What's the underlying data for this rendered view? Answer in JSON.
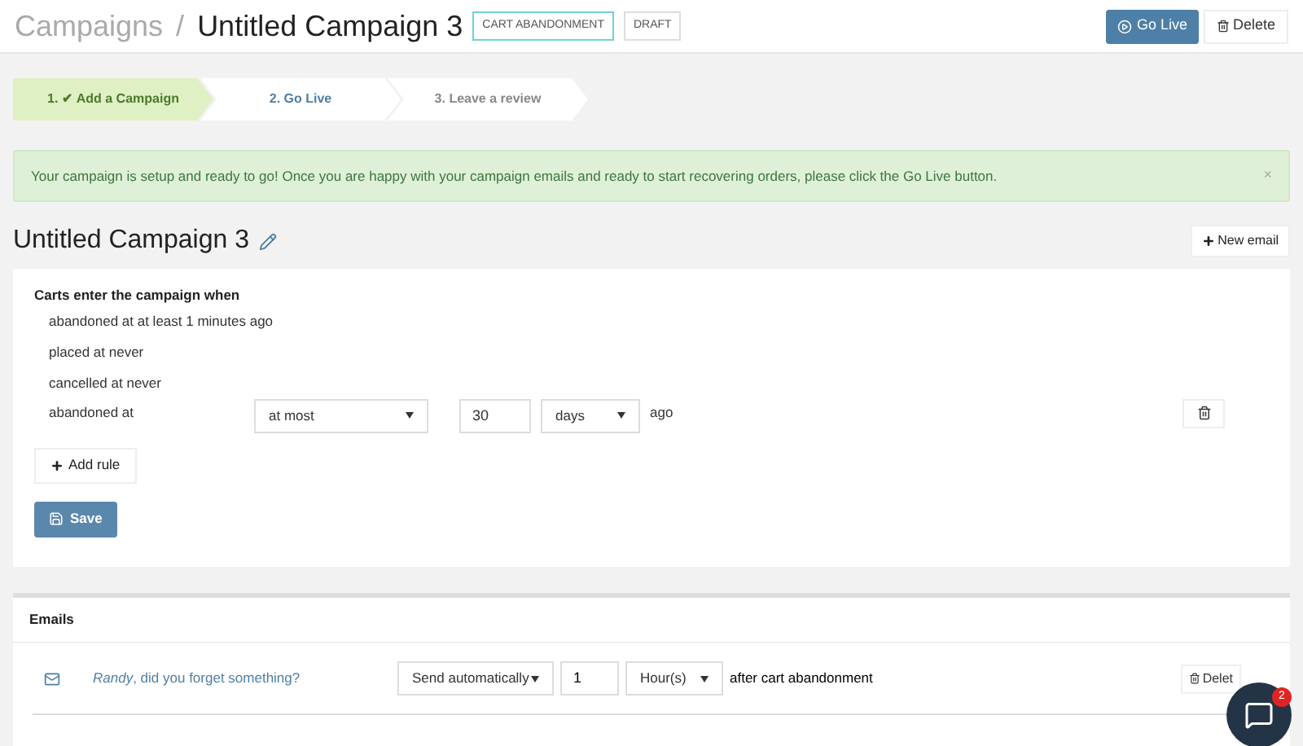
{
  "header": {
    "breadcrumb": "Campaigns",
    "separator": "/",
    "title": "Untitled Campaign 3",
    "badges": [
      {
        "label": "CART ABANDONMENT",
        "kind": "type"
      },
      {
        "label": "DRAFT",
        "kind": "status"
      }
    ],
    "go_live": "Go Live",
    "delete": "Delete"
  },
  "steps": [
    {
      "label": "1. ✔ Add a Campaign",
      "selected": true
    },
    {
      "label": "2. Go Live",
      "selected": false
    },
    {
      "label": "3. Leave a review",
      "selected": false
    }
  ],
  "alert": {
    "text": "Your campaign is setup and ready to go! Once you are happy with your campaign emails and ready to start recovering orders, please click the Go Live button.",
    "close": "×"
  },
  "campaign_title": "Untitled Campaign 3",
  "new_email": "New email",
  "rules_card": {
    "heading": "Carts enter the campaign when",
    "rules": [
      {
        "kind": "text",
        "text": "abandoned at at least 1 minutes ago"
      },
      {
        "kind": "text",
        "text": "placed at never"
      },
      {
        "kind": "text",
        "text": "cancelled at never"
      },
      {
        "kind": "editable",
        "text": "abandoned at",
        "comparator": "at most",
        "amount": "30",
        "unit": "days",
        "suffix": "ago"
      }
    ],
    "add_rule": "Add rule",
    "save": "Save"
  },
  "emails": {
    "heading": "Emails",
    "rows": [
      {
        "subject": "*Randy*, did you forget something?",
        "mode": "Send automatically",
        "amount": "1",
        "unit": "Hour(s)",
        "suffix": "after cart abandonment",
        "delete": "Delet"
      }
    ]
  },
  "chat": {
    "count": "2"
  }
}
